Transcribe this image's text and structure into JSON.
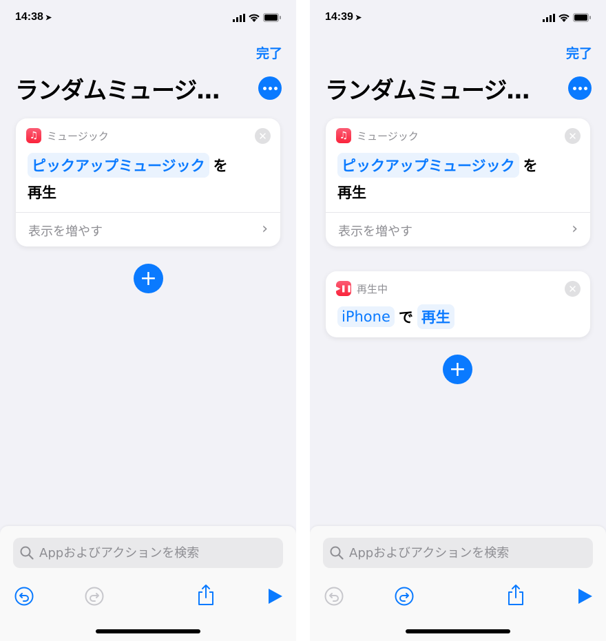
{
  "screens": [
    {
      "time": "14:38",
      "done_label": "完了",
      "title": "ランダムミュージ…",
      "actions": [
        {
          "app": "ミュージック",
          "token": "ピックアップミュージック",
          "suffix": "を",
          "line2": "再生",
          "show_more": "表示を増やす"
        }
      ],
      "search_placeholder": "Appおよびアクションを検索",
      "undo_enabled": true,
      "redo_enabled": false
    },
    {
      "time": "14:39",
      "done_label": "完了",
      "title": "ランダムミュージ…",
      "actions": [
        {
          "app": "ミュージック",
          "token": "ピックアップミュージック",
          "suffix": "を",
          "line2": "再生",
          "show_more": "表示を増やす"
        },
        {
          "app": "再生中",
          "token1": "iPhone",
          "connector": "で",
          "token2": "再生"
        }
      ],
      "search_placeholder": "Appおよびアクションを検索",
      "undo_enabled": false,
      "redo_enabled": true
    }
  ],
  "colors": {
    "accent": "#0a7aff",
    "disabled": "#c7c7cc",
    "music_red": "#fa233b"
  }
}
